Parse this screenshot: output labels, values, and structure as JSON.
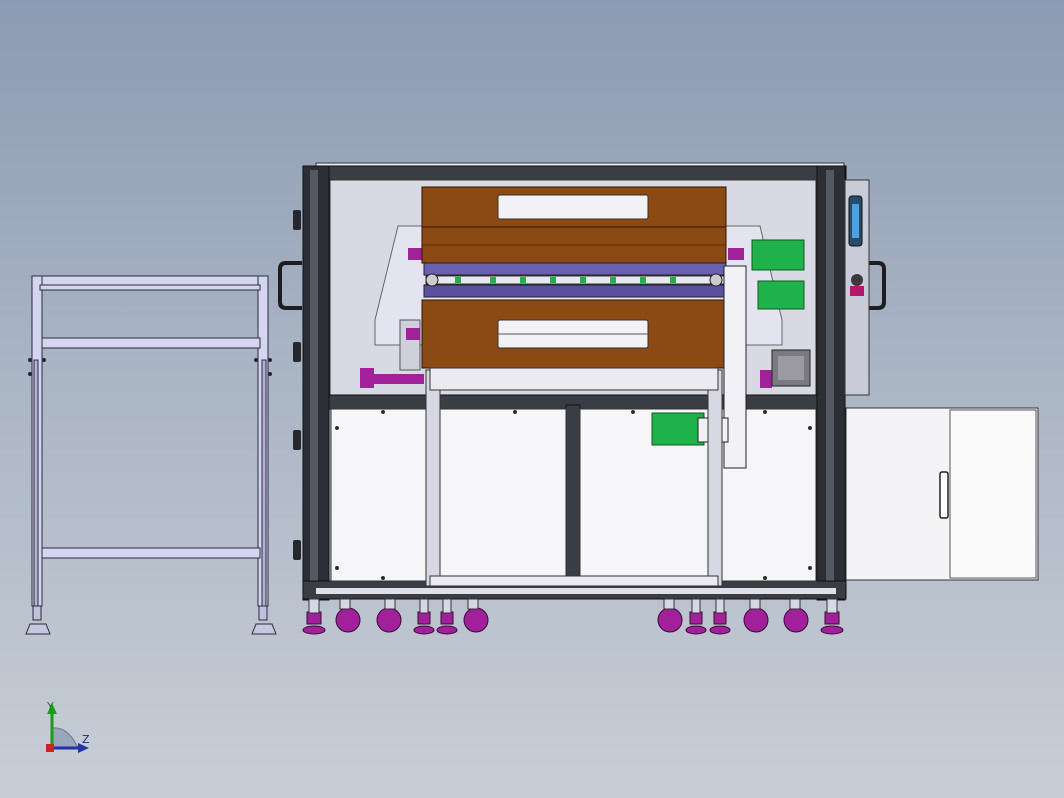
{
  "view": {
    "triad": {
      "y_label": "Y",
      "z_label": "Z"
    }
  },
  "colors": {
    "background_top": "#8b9bb3",
    "background_bottom": "#c9ced6",
    "frame_dark": "#2c2f35",
    "panel_light": "#f4f4f6",
    "inner_panel": "#d8d8e2",
    "brown_cover": "#8b4a14",
    "purple_part": "#a3209b",
    "green_motor": "#1fb24a",
    "cart_frame": "#c8c9e8",
    "roller": "#6b5fb2"
  },
  "icons": [
    "axis-triad-icon"
  ]
}
